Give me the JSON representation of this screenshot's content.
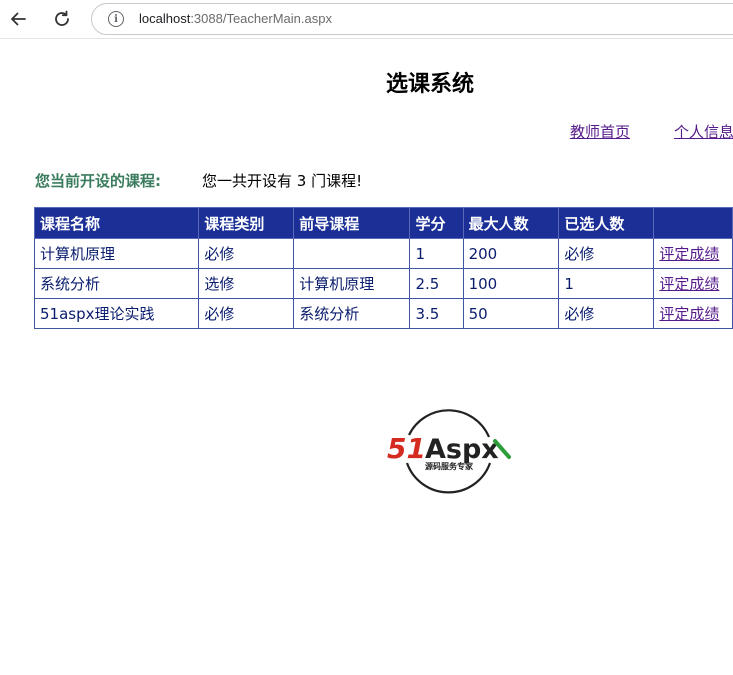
{
  "browser": {
    "url_host": "localhost",
    "url_rest": ":3088/TeacherMain.aspx"
  },
  "page": {
    "title": "选课系统",
    "nav": {
      "home_label": "教师首页",
      "profile_label": "个人信息"
    },
    "section_label": "您当前开设的课程:",
    "summary": "您一共开设有 3 门课程!"
  },
  "table": {
    "headers": [
      "课程名称",
      "课程类别",
      "前导课程",
      "学分",
      "最大人数",
      "已选人数",
      ""
    ],
    "rows": [
      {
        "name": "计算机原理",
        "category": "必修",
        "prereq": "",
        "credit": "1",
        "max": "200",
        "selected": "必修",
        "action": "评定成绩"
      },
      {
        "name": "系统分析",
        "category": "选修",
        "prereq": "计算机原理",
        "credit": "2.5",
        "max": "100",
        "selected": "1",
        "action": "评定成绩"
      },
      {
        "name": "51aspx理论实践",
        "category": "必修",
        "prereq": "系统分析",
        "credit": "3.5",
        "max": "50",
        "selected": "必修",
        "action": "评定成绩"
      }
    ]
  },
  "logo": {
    "brand_51": "51",
    "brand_aspx": "Aspx",
    "tagline": "源码服务专家",
    "colors": {
      "red": "#d42a20",
      "green": "#2e9e3a",
      "dark": "#222222"
    }
  }
}
